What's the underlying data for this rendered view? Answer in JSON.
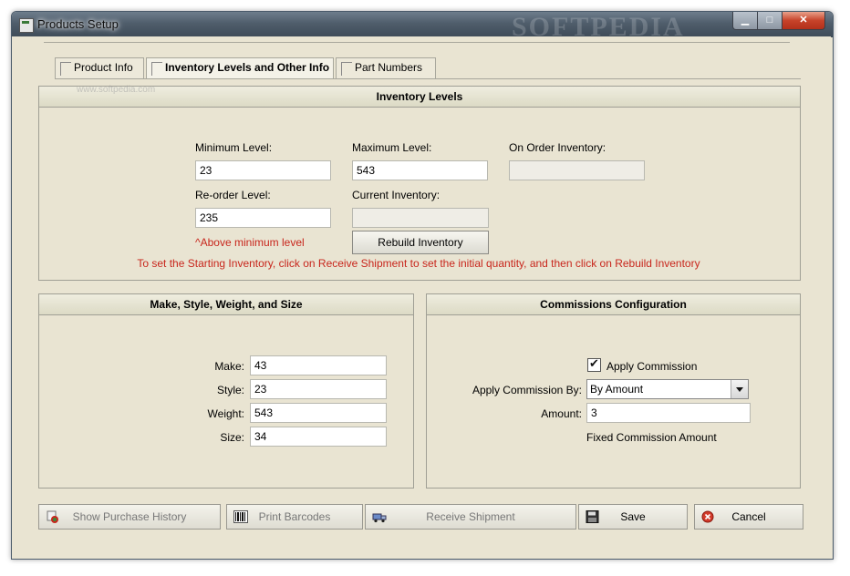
{
  "window": {
    "title": "Products Setup",
    "watermark": "SOFTPEDIA",
    "controls": {
      "minimize": "▁",
      "maximize": "□",
      "close": "✕"
    }
  },
  "tabs": [
    {
      "label": "Product Info",
      "active": false
    },
    {
      "label": "Inventory Levels and Other Info",
      "active": true
    },
    {
      "label": "Part Numbers",
      "active": false
    }
  ],
  "site_watermark": "www.softpedia.com",
  "inventory": {
    "header": "Inventory Levels",
    "min_label": "Minimum Level:",
    "min_value": "23",
    "max_label": "Maximum Level:",
    "max_value": "543",
    "onorder_label": "On Order Inventory:",
    "onorder_value": "",
    "reorder_label": "Re-order Level:",
    "reorder_value": "235",
    "current_label": "Current Inventory:",
    "current_value": "",
    "reorder_note": "^Above minimum level",
    "rebuild_label": "Rebuild Inventory",
    "hint": "To set the Starting Inventory, click on Receive Shipment to set the initial quantity, and then click on Rebuild Inventory"
  },
  "make_style": {
    "header": "Make, Style, Weight, and Size",
    "rows": [
      {
        "label": "Make:",
        "value": "43"
      },
      {
        "label": "Style:",
        "value": "23"
      },
      {
        "label": "Weight:",
        "value": "543"
      },
      {
        "label": "Size:",
        "value": "34"
      }
    ]
  },
  "commissions": {
    "header": "Commissions Configuration",
    "apply_label": "Apply Commission",
    "apply_checked": true,
    "by_label": "Apply Commission By:",
    "by_value": "By Amount",
    "amount_label": "Amount:",
    "amount_value": "3",
    "fixed_label": "Fixed Commission Amount"
  },
  "buttons": {
    "history": "Show Purchase History",
    "barcodes": "Print Barcodes",
    "receive": "Receive Shipment",
    "save": "Save",
    "cancel": "Cancel"
  },
  "colors": {
    "accent_red": "#c8261c",
    "panel_bg": "#e9e4d2"
  }
}
